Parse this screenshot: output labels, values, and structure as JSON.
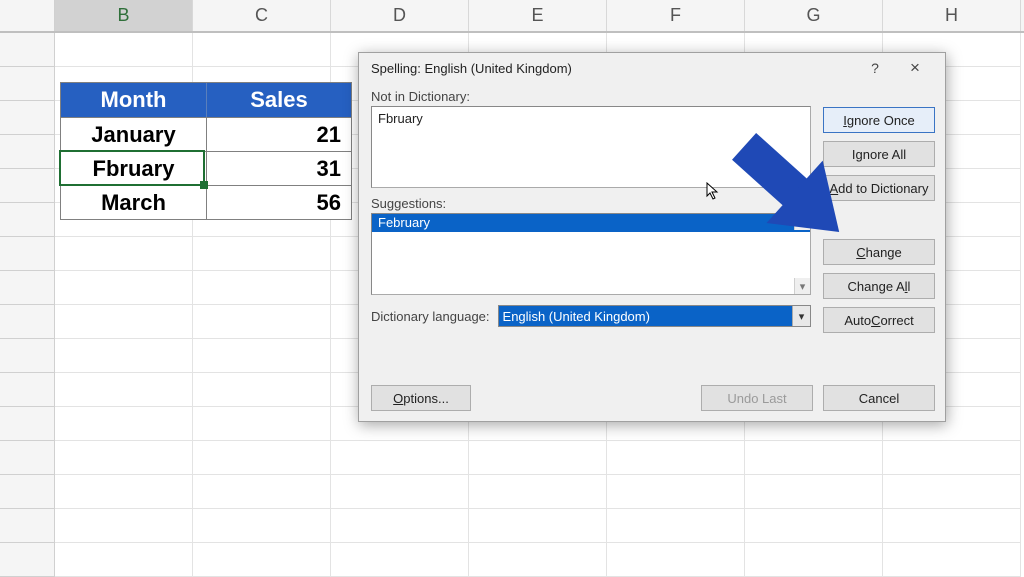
{
  "columns": [
    "B",
    "C",
    "D",
    "E",
    "F",
    "G",
    "H"
  ],
  "selected_column_index": 0,
  "table": {
    "headers": {
      "month": "Month",
      "sales": "Sales"
    },
    "rows": [
      {
        "month": "January",
        "sales": "21"
      },
      {
        "month": "Fbruary",
        "sales": "31"
      },
      {
        "month": "March",
        "sales": "56"
      }
    ]
  },
  "dialog": {
    "title": "Spelling: English (United Kingdom)",
    "help": "?",
    "close": "×",
    "not_in_dict_label": "Not in Dictionary:",
    "not_in_dict_value": "Fbruary",
    "suggestions_label": "Suggestions:",
    "suggestions": [
      "February"
    ],
    "dict_lang_label": "Dictionary language:",
    "dict_lang_value": "English (United Kingdom)",
    "buttons": {
      "ignore_once": {
        "pre": "",
        "u": "I",
        "post": "gnore Once"
      },
      "ignore_all": {
        "pre": "I",
        "u": "g",
        "post": "nore All"
      },
      "add_to_dict": {
        "pre": "",
        "u": "A",
        "post": "dd to Dictionary"
      },
      "change": {
        "pre": "",
        "u": "C",
        "post": "hange"
      },
      "change_all": {
        "pre": "Change A",
        "u": "l",
        "post": "l"
      },
      "autocorrect": {
        "pre": "Auto",
        "u": "C",
        "post": "orrect"
      },
      "options": {
        "pre": "",
        "u": "O",
        "post": "ptions..."
      },
      "undo_last": {
        "pre": "Undo Last",
        "u": "",
        "post": ""
      },
      "cancel": {
        "pre": "Cancel",
        "u": "",
        "post": ""
      }
    }
  },
  "colors": {
    "table_header_bg": "#2660c1",
    "select_bg": "#0a63c7",
    "arrow": "#1f49b6"
  }
}
